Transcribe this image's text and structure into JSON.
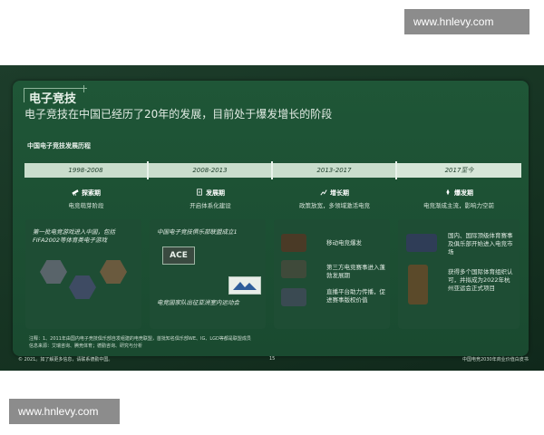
{
  "watermark": {
    "top": "www.hnlevy.com",
    "bottom": "www.hnlevy.com"
  },
  "slide": {
    "title": "电子竞技",
    "subtitle": "电子竞技在中国已经历了20年的发展，目前处于爆发增长的阶段",
    "section_title": "中国电子竞技发展历程",
    "timeline": [
      "1998-2008",
      "2008-2013",
      "2013-2017",
      "2017至今"
    ],
    "phases": [
      {
        "name": "探索期",
        "desc": "电竞萌芽阶段"
      },
      {
        "name": "发展期",
        "desc": "开启体系化建设"
      },
      {
        "name": "增长期",
        "desc": "政策放宽，多领域激活电竞"
      },
      {
        "name": "爆发期",
        "desc": "电竞渐成主流，影响力空前"
      }
    ],
    "card1": {
      "text": "第一批电竞游戏进入中国，包括FIFA2002等体育类电子游戏"
    },
    "card2": {
      "text1": "中国电子竞技俱乐部联盟成立1",
      "text2": "电竞国家队出征亚洲室内运动会",
      "logo": "ACE"
    },
    "card3": {
      "items": [
        "移动电竞爆发",
        "第三方电竞赛事进入蓬勃发展期",
        "直播平台助力传播，促进赛事版权价值"
      ]
    },
    "card4": {
      "items": [
        "国内、国际顶级体育赛事及俱乐部开始进入电竞市场",
        "获得多个国际体育组织认可，并拟成为2022年杭州亚运会正式项目"
      ]
    },
    "footnote": "注释：1、2011年由国内电子竞技俱乐部自发组建的电竞联盟，首批知名俱乐部WE、IG、LGD等都是联盟成员",
    "source": "信息来源：艾瑞咨询、腾竞体育；德勤咨询、研究与分析",
    "footer_left": "© 2021。如了解更多信息，请联系德勤中国。",
    "footer_center": "15",
    "footer_right": "中国电竞2030年商业价值白皮书"
  }
}
